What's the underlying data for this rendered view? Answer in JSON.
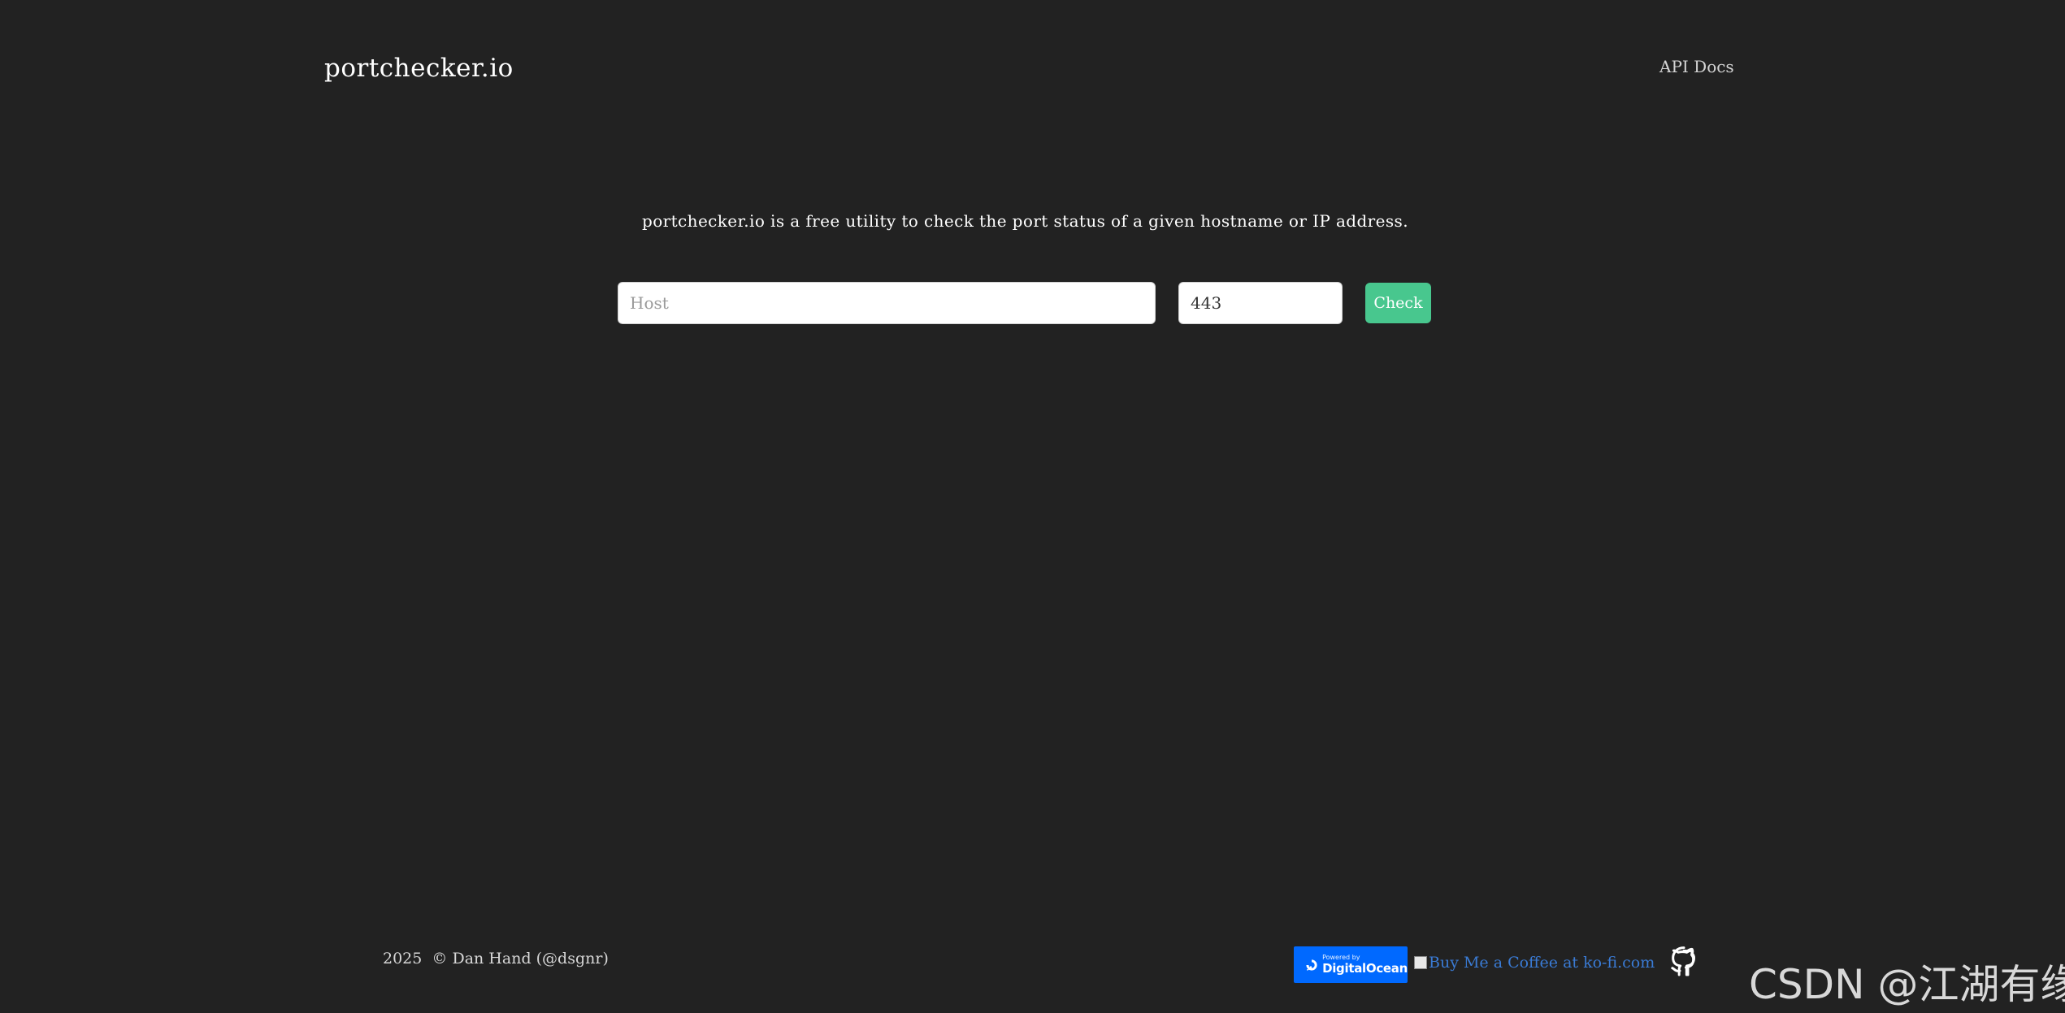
{
  "header": {
    "brand": "portchecker.io",
    "nav_api_docs": "API Docs"
  },
  "main": {
    "tagline": "portchecker.io is a free utility to check the port status of a given hostname or IP address.",
    "host_placeholder": "Host",
    "host_value": "",
    "port_value": "443",
    "check_label": "Check"
  },
  "footer": {
    "copyright": "2025  © Dan Hand (@dsgnr)",
    "do_badge_small": "Powered by",
    "do_badge_big": "DigitalOcean",
    "kofi_alt_text": "Buy Me a Coffee at ko-fi.com",
    "github_icon": "github-icon"
  },
  "watermark": {
    "text": "CSDN @江湖有缘"
  },
  "colors": {
    "background": "#222222",
    "accent": "#48c78e",
    "do_blue": "#0069ff",
    "link_blue": "#3a7bd5"
  }
}
